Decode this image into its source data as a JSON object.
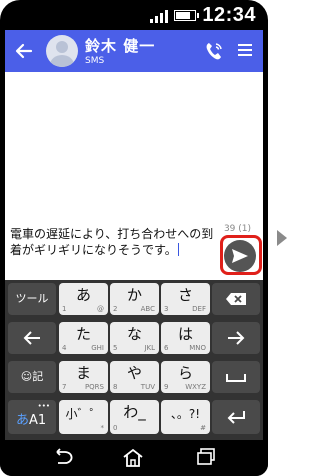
{
  "status": {
    "time": "12:34"
  },
  "header": {
    "contact_name": "鈴木 健一",
    "subtitle": "SMS"
  },
  "composer": {
    "counter": "39 (1)",
    "message": "電車の遅延により、打ち合わせへの到着がギリギリになりそうです。"
  },
  "keyboard": {
    "tool_key": "ツール",
    "emoji_key": "☺記",
    "mode_key_main": "あ",
    "mode_key_sub": "A1",
    "row1": [
      {
        "main": "あ",
        "dig": "1",
        "sub": "@"
      },
      {
        "main": "か",
        "dig": "2",
        "sub": "ABC"
      },
      {
        "main": "さ",
        "dig": "3",
        "sub": "DEF"
      }
    ],
    "row2": [
      {
        "main": "た",
        "dig": "4",
        "sub": "GHI"
      },
      {
        "main": "な",
        "dig": "5",
        "sub": "JKL"
      },
      {
        "main": "は",
        "dig": "6",
        "sub": "MNO"
      }
    ],
    "row3": [
      {
        "main": "ま",
        "dig": "7",
        "sub": "PQRS"
      },
      {
        "main": "や",
        "dig": "8",
        "sub": "TUV"
      },
      {
        "main": "ら",
        "dig": "9",
        "sub": "WXYZ"
      }
    ],
    "row4": [
      {
        "main": "小゛゜",
        "dig": "",
        "sub": "*"
      },
      {
        "main": "わ_",
        "dig": "0",
        "sub": ""
      },
      {
        "main": "、。?!",
        "dig": "",
        "sub": "#"
      }
    ]
  }
}
